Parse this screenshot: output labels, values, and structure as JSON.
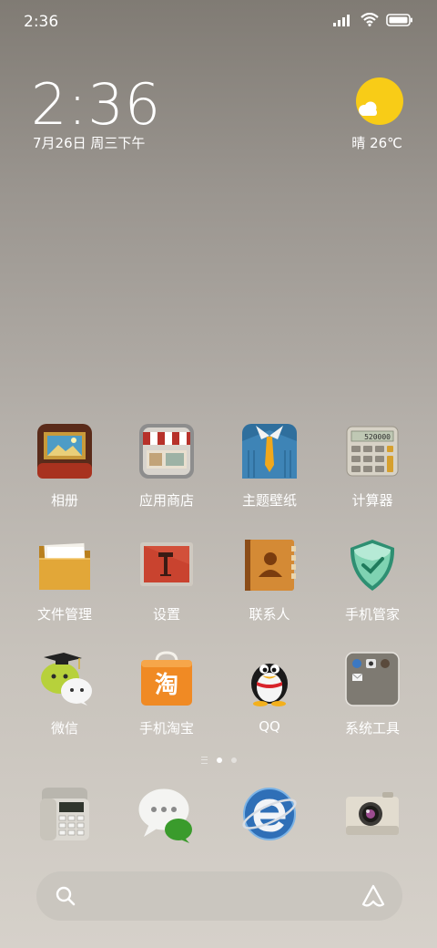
{
  "status_bar": {
    "time": "2:36",
    "icons": [
      "signal-icon",
      "wifi-icon",
      "battery-icon"
    ]
  },
  "widget": {
    "clock": "2:36",
    "date": "7月26日 周三下午",
    "weather": "晴 26℃",
    "weather_icon": "sunny-icon"
  },
  "apps": [
    {
      "label": "相册",
      "icon": "gallery-icon"
    },
    {
      "label": "应用商店",
      "icon": "app-store-icon"
    },
    {
      "label": "主题壁纸",
      "icon": "themes-icon"
    },
    {
      "label": "计算器",
      "icon": "calculator-icon"
    },
    {
      "label": "文件管理",
      "icon": "file-manager-icon"
    },
    {
      "label": "设置",
      "icon": "settings-icon"
    },
    {
      "label": "联系人",
      "icon": "contacts-icon"
    },
    {
      "label": "手机管家",
      "icon": "security-icon"
    },
    {
      "label": "微信",
      "icon": "wechat-icon"
    },
    {
      "label": "手机淘宝",
      "icon": "taobao-icon"
    },
    {
      "label": "QQ",
      "icon": "qq-icon"
    },
    {
      "label": "系统工具",
      "icon": "system-tools-folder-icon"
    }
  ],
  "dock": [
    {
      "icon": "phone-icon"
    },
    {
      "icon": "messages-icon"
    },
    {
      "icon": "browser-icon"
    },
    {
      "icon": "camera-icon"
    }
  ],
  "calculator_display": "520000",
  "taobao_glyph": "淘",
  "page_indicator": {
    "pages": 2,
    "current": 1
  },
  "search": {
    "placeholder": ""
  }
}
